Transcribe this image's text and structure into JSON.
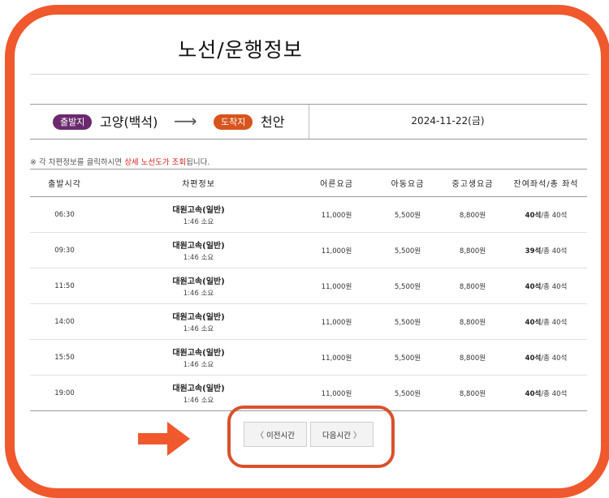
{
  "page": {
    "title": "노선/운행정보"
  },
  "route": {
    "departure_badge": "출발지",
    "departure_city": "고양(백석)",
    "arrival_badge": "도착지",
    "arrival_city": "천안",
    "date": "2024-11-22(금)"
  },
  "notice": {
    "prefix": "※ 각 차편정보를 클릭하시면 ",
    "highlight": "상세 노선도가 조회",
    "suffix": "됩니다."
  },
  "table": {
    "headers": [
      "출발시각",
      "차편정보",
      "어른요금",
      "아동요금",
      "중고생요금",
      "잔여좌석/총 좌석"
    ],
    "rows": [
      {
        "time": "06:30",
        "bus": "대원고속(일반)",
        "duration": "1:46 소요",
        "adult": "11,000원",
        "child": "5,500원",
        "student": "8,800원",
        "seats": "40석",
        "total": "/총 40석"
      },
      {
        "time": "09:30",
        "bus": "대원고속(일반)",
        "duration": "1:46 소요",
        "adult": "11,000원",
        "child": "5,500원",
        "student": "8,800원",
        "seats": "39석",
        "total": "/총 40석"
      },
      {
        "time": "11:50",
        "bus": "대원고속(일반)",
        "duration": "1:46 소요",
        "adult": "11,000원",
        "child": "5,500원",
        "student": "8,800원",
        "seats": "40석",
        "total": "/총 40석"
      },
      {
        "time": "14:00",
        "bus": "대원고속(일반)",
        "duration": "1:46 소요",
        "adult": "11,000원",
        "child": "5,500원",
        "student": "8,800원",
        "seats": "40석",
        "total": "/총 40석"
      },
      {
        "time": "15:50",
        "bus": "대원고속(일반)",
        "duration": "1:46 소요",
        "adult": "11,000원",
        "child": "5,500원",
        "student": "8,800원",
        "seats": "40석",
        "total": "/총 40석"
      },
      {
        "time": "19:00",
        "bus": "대원고속(일반)",
        "duration": "1:46 소요",
        "adult": "11,000원",
        "child": "5,500원",
        "student": "8,800원",
        "seats": "40석",
        "total": "/총 40석"
      }
    ]
  },
  "pagination": {
    "prev_label": "이전시간",
    "next_label": "다음시간"
  },
  "colors": {
    "frame": "#f0582d",
    "departure_badge": "#6b2a6d",
    "arrival_badge": "#d8531d",
    "highlight": "#d31c1c"
  },
  "icons": {
    "route_arrow": "arrow-right-icon",
    "prev": "chevron-left-icon",
    "next": "chevron-right-icon",
    "pointer": "red-arrow-icon"
  }
}
